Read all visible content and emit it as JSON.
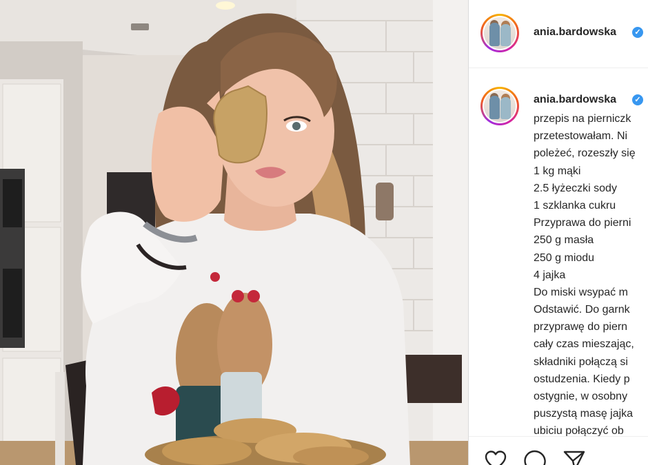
{
  "post": {
    "author": {
      "username": "ania.bardowska",
      "verified_mark": "✓",
      "avatar_icon": "avatar-photo"
    },
    "caption_lines": [
      "przepis na pierniczk",
      "przetestowałam. Ni",
      "poleżeć, rozeszły się",
      "1 kg mąki",
      "2.5 łyżeczki sody",
      "1 szklanka cukru",
      "Przyprawa do pierni",
      "250 g masła",
      "250 g miodu",
      "4 jajka",
      "Do miski wsypać m",
      "Odstawić. Do garnk",
      "przyprawę do piern",
      "cały czas mieszając,",
      "składniki połączą si",
      "ostudzenia. Kiedy p",
      "ostygnie, w osobny",
      "puszystą masę jajka",
      "ubiciu połączyć ob"
    ],
    "actions": [
      {
        "name": "like",
        "icon": "heart-icon"
      },
      {
        "name": "comment",
        "icon": "comment-icon"
      },
      {
        "name": "share",
        "icon": "paper-plane-icon"
      }
    ]
  },
  "colors": {
    "text": "#262626",
    "verified": "#3897f0",
    "divider": "#efefef"
  }
}
